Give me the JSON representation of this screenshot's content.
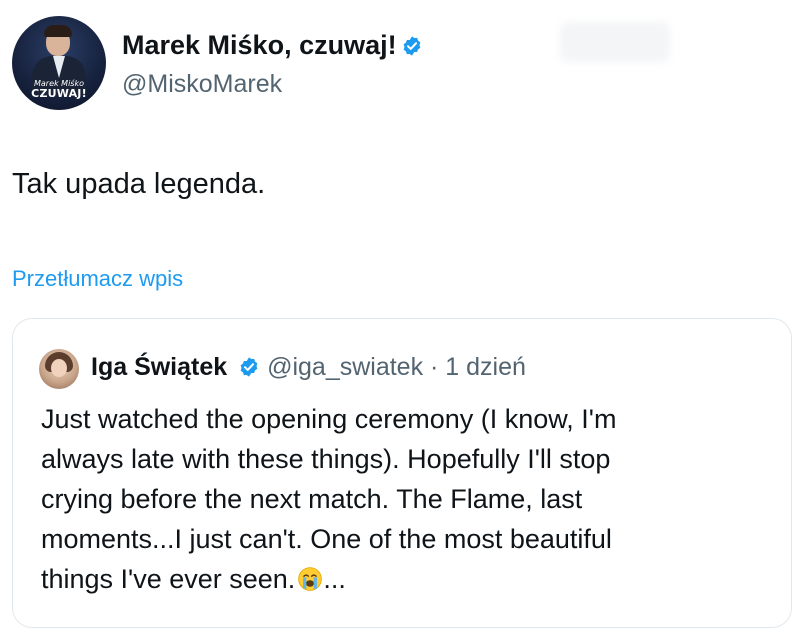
{
  "tweet": {
    "author_name": "Marek Miśko, czuwaj!",
    "author_handle": "@MiskoMarek",
    "avatar_caption_line1": "Marek Miśko",
    "avatar_caption_line2": "CZUWAJ!",
    "text": "Tak upada legenda.",
    "translate_link": "Przetłumacz wpis"
  },
  "quoted_tweet": {
    "author_name": "Iga Świątek",
    "meta": "@iga_swiatek · 1 dzień",
    "lines": [
      "Just watched the opening ceremony (I know, I'm",
      "always late with these things). Hopefully I'll stop",
      "crying before the next match. The Flame, last",
      "moments...I just can't. One of the most beautiful",
      "things I've ever seen."
    ],
    "trailing": "..."
  },
  "colors": {
    "verified": "#1d9bf0",
    "link": "#1d9bf0",
    "secondary_text": "#536471",
    "border": "#e1e8ed"
  },
  "icons": {
    "verified": "verified-badge-icon",
    "emoji": "loudly-crying-face-emoji"
  }
}
